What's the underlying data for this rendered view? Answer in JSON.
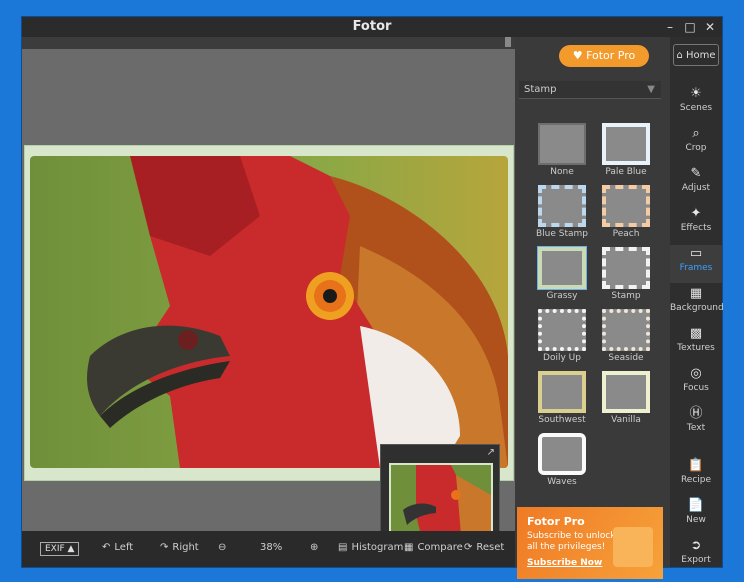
{
  "window": {
    "title": "Fotor"
  },
  "header": {
    "pro_button": "Fotor Pro",
    "home_label": "Home"
  },
  "stamp_panel": {
    "category": "Stamp",
    "tiles": [
      {
        "label": "None"
      },
      {
        "label": "Pale Blue"
      },
      {
        "label": "Blue Stamp"
      },
      {
        "label": "Peach"
      },
      {
        "label": "Grassy"
      },
      {
        "label": "Stamp"
      },
      {
        "label": "Doily Up"
      },
      {
        "label": "Seaside"
      },
      {
        "label": "Southwest"
      },
      {
        "label": "Vanilla"
      },
      {
        "label": "Waves"
      }
    ]
  },
  "promo": {
    "title": "Fotor Pro",
    "text": "Subscribe to unlock all the privileges!",
    "link": "Subscribe Now"
  },
  "rail": [
    {
      "label": "Scenes",
      "icon": "sun-icon"
    },
    {
      "label": "Crop",
      "icon": "crop-icon"
    },
    {
      "label": "Adjust",
      "icon": "pencil-icon"
    },
    {
      "label": "Effects",
      "icon": "sparkle-icon"
    },
    {
      "label": "Frames",
      "icon": "frame-icon"
    },
    {
      "label": "Background",
      "icon": "background-icon"
    },
    {
      "label": "Textures",
      "icon": "texture-icon"
    },
    {
      "label": "Focus",
      "icon": "focus-icon"
    },
    {
      "label": "Text",
      "icon": "text-icon"
    },
    {
      "label": "Recipe",
      "icon": "recipe-icon"
    },
    {
      "label": "New",
      "icon": "new-icon"
    },
    {
      "label": "Export",
      "icon": "export-icon"
    }
  ],
  "bottombar": {
    "exif": "EXIF",
    "rotate_left": "Left",
    "rotate_right": "Right",
    "zoom": "38%",
    "histogram": "Histogram",
    "compare": "Compare",
    "reset": "Reset"
  },
  "colors": {
    "accent": "#3aa0ff",
    "pro": "#f39a2c",
    "frame": "#d8e6cc"
  }
}
